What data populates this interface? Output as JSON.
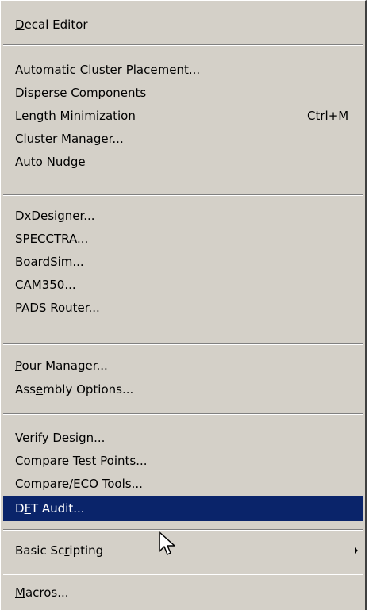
{
  "menu": {
    "items": [
      {
        "pre": "",
        "key": "D",
        "post": "ecal Editor",
        "shortcut": ""
      },
      {
        "pre": "Automatic ",
        "key": "C",
        "post": "luster Placement...",
        "shortcut": ""
      },
      {
        "pre": "Disperse C",
        "key": "o",
        "post": "mponents",
        "shortcut": ""
      },
      {
        "pre": "",
        "key": "L",
        "post": "ength Minimization",
        "shortcut": "Ctrl+M"
      },
      {
        "pre": "Cl",
        "key": "u",
        "post": "ster Manager...",
        "shortcut": ""
      },
      {
        "pre": "Auto ",
        "key": "N",
        "post": "udge",
        "shortcut": ""
      },
      {
        "pre": "DxDesi",
        "key": "g",
        "post": "ner...",
        "shortcut": ""
      },
      {
        "pre": "",
        "key": "S",
        "post": "PECCTRA...",
        "shortcut": ""
      },
      {
        "pre": "",
        "key": "B",
        "post": "oardSim...",
        "shortcut": ""
      },
      {
        "pre": "C",
        "key": "A",
        "post": "M350...",
        "shortcut": ""
      },
      {
        "pre": "PADS ",
        "key": "R",
        "post": "outer...",
        "shortcut": ""
      },
      {
        "pre": "",
        "key": "P",
        "post": "our Manager...",
        "shortcut": ""
      },
      {
        "pre": "Ass",
        "key": "e",
        "post": "mbly Options...",
        "shortcut": ""
      },
      {
        "pre": "",
        "key": "V",
        "post": "erify Design...",
        "shortcut": ""
      },
      {
        "pre": "Compare ",
        "key": "T",
        "post": "est Points...",
        "shortcut": ""
      },
      {
        "pre": "Compare/",
        "key": "E",
        "post": "CO Tools...",
        "shortcut": ""
      },
      {
        "pre": "D",
        "key": "F",
        "post": "T Audit...",
        "shortcut": ""
      },
      {
        "pre": "Basic Sc",
        "key": "r",
        "post": "ipting",
        "shortcut": ""
      },
      {
        "pre": "",
        "key": "M",
        "post": "acros...",
        "shortcut": ""
      }
    ]
  },
  "colors": {
    "menu_bg": "#d4d0c8",
    "highlight_bg": "#0a246a",
    "highlight_text": "#ffffff"
  },
  "icons": {
    "submenu": "triangle-right-icon",
    "pointer": "mouse-cursor-icon"
  }
}
